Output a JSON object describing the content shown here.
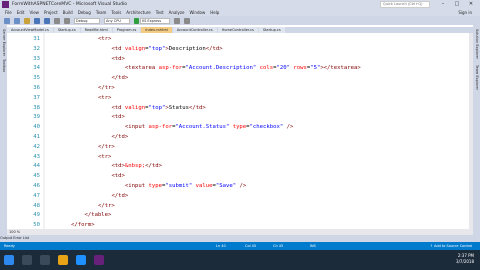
{
  "window": {
    "title": "FormWithASPNETCoreMVC - Microsoft Visual Studio",
    "quick_launch": "Quick Launch (Ctrl+Q)",
    "min": "–",
    "max": "□",
    "close": "✕"
  },
  "menu": [
    "File",
    "Edit",
    "View",
    "Project",
    "Build",
    "Debug",
    "Team",
    "Tools",
    "Architecture",
    "Test",
    "Analyze",
    "Window",
    "Help"
  ],
  "signin": "Sign in",
  "toolbar": {
    "config": "Debug",
    "platform": "Any CPU",
    "run": "IIS Express"
  },
  "left_rail": [
    "Server Explorer",
    "Toolbox"
  ],
  "right_rail": [
    "Solution Explorer",
    "Team Explorer"
  ],
  "tabs": [
    "AccountViewModel.cs",
    "Startup.cs",
    "ReadMe.html",
    "Program.cs",
    "Index.cshtml",
    "AccountController.cs",
    "HomeController.cs",
    "Startup.cs"
  ],
  "active_tab": 4,
  "code": {
    "lines": [
      "31",
      "32",
      "33",
      "34",
      "35",
      "36",
      "37",
      "38",
      "39",
      "40",
      "41",
      "42",
      "43",
      "44",
      "45",
      "46",
      "47",
      "48",
      "49",
      "50"
    ]
  },
  "zoom": "100 %",
  "bottom_tabs": "Output   Error List",
  "status": {
    "ready": "Ready",
    "ln": "Ln 40",
    "col": "Col 45",
    "ch": "Ch 45",
    "ins": "INS",
    "source": "↑ Add to Source Control"
  },
  "clock": {
    "time": "2:37 PM",
    "date": "3/7/2018"
  },
  "colors": {
    "accent": "#007acc",
    "tag": "#800000",
    "attribute": "#ff0000",
    "value": "#0000ff",
    "line_number": "#2b91af"
  }
}
